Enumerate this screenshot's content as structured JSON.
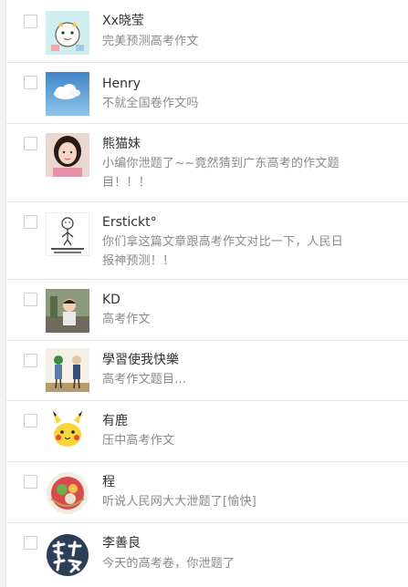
{
  "messages": [
    {
      "name": "Xx晓莹",
      "text": "完美预测高考作文",
      "avatar": "cartoon-character-avatar"
    },
    {
      "name": "Henry",
      "text": "不就全国卷作文吗",
      "avatar": "cloud-sky-avatar"
    },
    {
      "name": "熊猫妹",
      "text": "小编你泄题了~~竟然猜到广东高考的作文题目！！！",
      "avatar": "portrait-avatar"
    },
    {
      "name": "Erstickt°",
      "text": "你们拿这篇文章跟高考作文对比一下，人民日报神预测！！",
      "avatar": "stickman-avatar"
    },
    {
      "name": "KD",
      "text": "高考作文",
      "avatar": "child-photo-avatar"
    },
    {
      "name": "學習使我快樂",
      "text": "高考作文题目...",
      "avatar": "two-figures-avatar"
    },
    {
      "name": "有鹿",
      "text": "压中高考作文",
      "avatar": "pikachu-avatar"
    },
    {
      "name": "程",
      "text": "听说人民网大大泄题了[愉快]",
      "avatar": "fruit-plate-avatar"
    },
    {
      "name": "李善良",
      "text": "今天的高考卷，你泄题了",
      "avatar": "calligraphy-avatar"
    }
  ]
}
